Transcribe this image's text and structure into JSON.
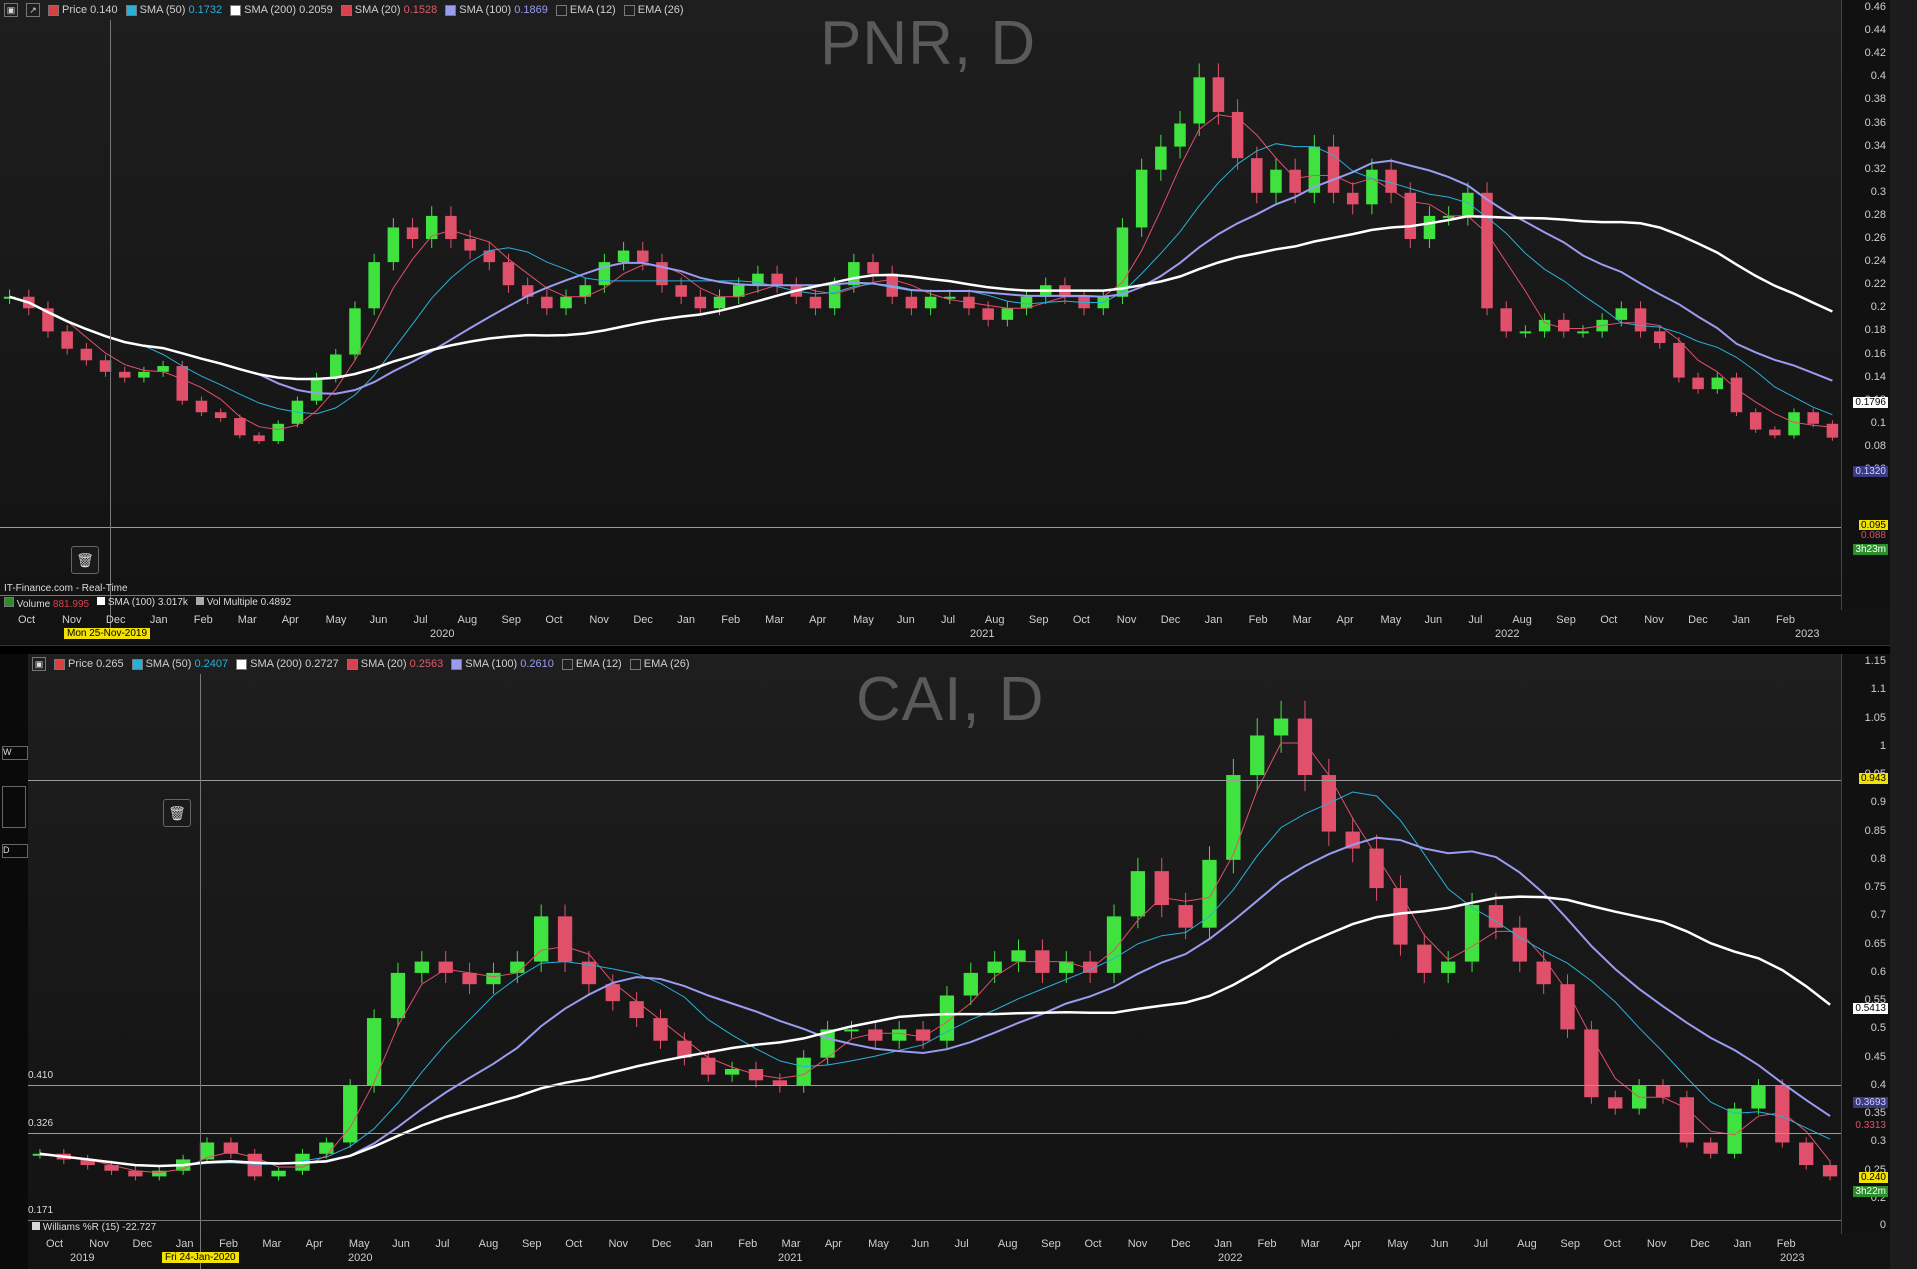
{
  "top_chart": {
    "title": "PNR, D",
    "legend": [
      {
        "label": "Price",
        "value": "0.140",
        "color": "#d94040"
      },
      {
        "label": "SMA (50)",
        "value": "0.1732",
        "color": "#2ab0d8"
      },
      {
        "label": "SMA (200)",
        "value": "0.2059",
        "color": "#ffffff"
      },
      {
        "label": "SMA (20)",
        "value": "0.1528",
        "color": "#d94050"
      },
      {
        "label": "SMA (100)",
        "value": "0.1869",
        "color": "#9a9cf0"
      },
      {
        "label": "EMA (12)",
        "value": "",
        "color": "#222222"
      },
      {
        "label": "EMA (26)",
        "value": "",
        "color": "#222222"
      }
    ],
    "y_ticks": [
      "0.46",
      "0.44",
      "0.42",
      "0.4",
      "0.38",
      "0.36",
      "0.34",
      "0.32",
      "0.3",
      "0.28",
      "0.26",
      "0.24",
      "0.22",
      "0.2",
      "0.18",
      "0.16",
      "0.14",
      "0.12",
      "0.1",
      "0.08",
      "0.06"
    ],
    "tags": {
      "sma200": "0.1796",
      "sma100": "0.1320",
      "price": "0.095",
      "price2": "0.088",
      "timer": "3h23m"
    },
    "source": "IT-Finance.com - Real-Time",
    "volume_legend": [
      {
        "label": "Volume",
        "value": "881.995"
      },
      {
        "label": "SMA (100)",
        "value": "3.017k"
      },
      {
        "label": "Vol Multiple",
        "value": "0.4892"
      }
    ],
    "x_labels": [
      "Oct",
      "Nov",
      "Dec",
      "Jan",
      "Feb",
      "Mar",
      "Apr",
      "May",
      "Jun",
      "Jul",
      "Aug",
      "Sep",
      "Oct",
      "Nov",
      "Dec",
      "Jan",
      "Feb",
      "Mar",
      "Apr",
      "May",
      "Jun",
      "Jul",
      "Aug",
      "Sep",
      "Oct",
      "Nov",
      "Dec",
      "Jan",
      "Feb",
      "Mar",
      "Apr",
      "May",
      "Jun",
      "Jul",
      "Aug",
      "Sep",
      "Oct",
      "Nov",
      "Dec",
      "Jan",
      "Feb"
    ],
    "years": [
      "2020",
      "2021",
      "2022",
      "2023"
    ],
    "crosshair_date": "Mon 25-Nov-2019",
    "price_series": [
      0.21,
      0.2,
      0.18,
      0.165,
      0.155,
      0.145,
      0.14,
      0.145,
      0.15,
      0.12,
      0.11,
      0.105,
      0.09,
      0.085,
      0.1,
      0.12,
      0.14,
      0.16,
      0.2,
      0.24,
      0.27,
      0.26,
      0.28,
      0.26,
      0.25,
      0.24,
      0.22,
      0.21,
      0.2,
      0.21,
      0.22,
      0.24,
      0.25,
      0.24,
      0.22,
      0.21,
      0.2,
      0.21,
      0.22,
      0.23,
      0.22,
      0.21,
      0.2,
      0.22,
      0.24,
      0.23,
      0.21,
      0.2,
      0.21,
      0.21,
      0.2,
      0.19,
      0.2,
      0.21,
      0.22,
      0.21,
      0.2,
      0.21,
      0.27,
      0.32,
      0.34,
      0.36,
      0.4,
      0.37,
      0.33,
      0.3,
      0.32,
      0.3,
      0.34,
      0.3,
      0.29,
      0.32,
      0.3,
      0.26,
      0.28,
      0.28,
      0.3,
      0.2,
      0.18,
      0.18,
      0.19,
      0.18,
      0.18,
      0.19,
      0.2,
      0.18,
      0.17,
      0.14,
      0.13,
      0.14,
      0.11,
      0.095,
      0.09,
      0.11,
      0.1,
      0.088
    ]
  },
  "bottom_chart": {
    "title": "CAI, D",
    "legend": [
      {
        "label": "Price",
        "value": "0.265",
        "color": "#d94040"
      },
      {
        "label": "SMA (50)",
        "value": "0.2407",
        "color": "#2ab0d8"
      },
      {
        "label": "SMA (200)",
        "value": "0.2727",
        "color": "#ffffff"
      },
      {
        "label": "SMA (20)",
        "value": "0.2563",
        "color": "#d94050"
      },
      {
        "label": "SMA (100)",
        "value": "0.2610",
        "color": "#9a9cf0"
      },
      {
        "label": "EMA (12)",
        "value": "",
        "color": "#222222"
      },
      {
        "label": "EMA (26)",
        "value": "",
        "color": "#222222"
      }
    ],
    "y_ticks": [
      "1.15",
      "1.1",
      "1.05",
      "1",
      "0.95",
      "0.9",
      "0.85",
      "0.8",
      "0.75",
      "0.7",
      "0.65",
      "0.6",
      "0.55",
      "0.5",
      "0.45",
      "0.4",
      "0.35",
      "0.3",
      "0.25",
      "0.2"
    ],
    "tags": {
      "level1": "0.943",
      "sma200": "0.5413",
      "sma100": "0.3693",
      "sma50": "0.3313",
      "price": "0.240",
      "timer": "3h22m"
    },
    "left_levels": [
      "0.410",
      "0.326",
      "0.171"
    ],
    "williams": {
      "label": "Williams %R (15)",
      "value": "-22.727",
      "scale": "0"
    },
    "x_labels": [
      "Oct",
      "Nov",
      "Dec",
      "Jan",
      "Feb",
      "Mar",
      "Apr",
      "May",
      "Jun",
      "Jul",
      "Aug",
      "Sep",
      "Oct",
      "Nov",
      "Dec",
      "Jan",
      "Feb",
      "Mar",
      "Apr",
      "May",
      "Jun",
      "Jul",
      "Aug",
      "Sep",
      "Oct",
      "Nov",
      "Dec",
      "Jan",
      "Feb",
      "Mar",
      "Apr",
      "May",
      "Jun",
      "Jul",
      "Aug",
      "Sep",
      "Oct",
      "Nov",
      "Dec",
      "Jan",
      "Feb"
    ],
    "years": [
      "2019",
      "2020",
      "2021",
      "2022",
      "2023"
    ],
    "crosshair_date": "Fri 24-Jan-2020",
    "price_series": [
      0.28,
      0.27,
      0.26,
      0.25,
      0.24,
      0.25,
      0.27,
      0.3,
      0.28,
      0.24,
      0.25,
      0.28,
      0.3,
      0.4,
      0.52,
      0.6,
      0.62,
      0.6,
      0.58,
      0.6,
      0.62,
      0.7,
      0.62,
      0.58,
      0.55,
      0.52,
      0.48,
      0.45,
      0.42,
      0.43,
      0.41,
      0.4,
      0.45,
      0.5,
      0.5,
      0.48,
      0.5,
      0.48,
      0.56,
      0.6,
      0.62,
      0.64,
      0.6,
      0.62,
      0.6,
      0.7,
      0.78,
      0.72,
      0.68,
      0.8,
      0.95,
      1.02,
      1.05,
      0.95,
      0.85,
      0.82,
      0.75,
      0.65,
      0.6,
      0.62,
      0.72,
      0.68,
      0.62,
      0.58,
      0.5,
      0.38,
      0.36,
      0.4,
      0.38,
      0.3,
      0.28,
      0.36,
      0.4,
      0.3,
      0.26,
      0.24
    ]
  }
}
